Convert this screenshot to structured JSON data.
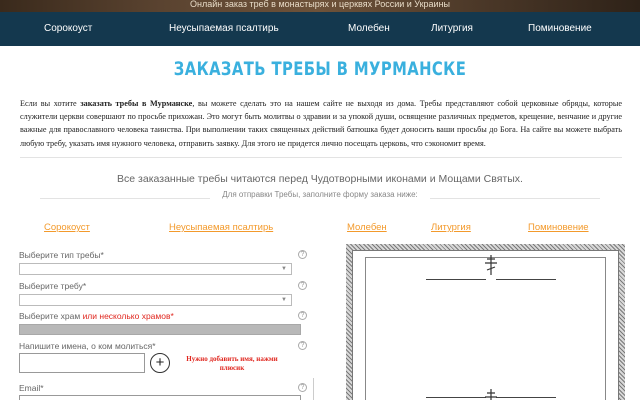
{
  "topbar": {
    "text": "Онлайн заказ треб в монастырях и церквях России и Украины"
  },
  "nav": {
    "items": [
      "Сорокоуст",
      "Неусыпаемая псалтирь",
      "Молебен",
      "Литургия",
      "Поминовение"
    ]
  },
  "title": "ЗАКАЗАТЬ ТРЕБЫ В МУРМАНСКЕ",
  "intro": {
    "lead": "Если вы хотите ",
    "bold": "заказать требы в Мурманске",
    "rest": ", вы можете сделать это на нашем сайте не выходя из дома. Требы представляют собой церковные обряды, которые служители церкви совершают по просьбе прихожан. Это могут быть молитвы о здравии и за упокой души, освящение различных предметов, крещение, венчание и другие важные для православного человека таинства. При выполнении таких священных действий батюшка будет доносить ваши просьбы до Бога. На сайте вы можете выбрать любую требу, указать имя нужного человека, отправить заявку. Для этого не придется лично посещать церковь, что сэкономит время."
  },
  "subheading": "Все заказанные требы читаются перед Чудотворными иконами и Мощами Святых.",
  "subnote": "Для отправки Требы, заполните форму заказа ниже:",
  "tabs": [
    "Сорокоуст",
    "Неусыпаемая псалтирь",
    "Молебен",
    "Литургия",
    "Поминовение"
  ],
  "form": {
    "type_label": "Выберите тип требы*",
    "treba_label": "Выберите требу*",
    "temple_label": "Выберите храм ",
    "temple_label_red": "или несколько храмов*",
    "names_label": "Напишите имена, о ком молиться*",
    "plus": "+",
    "warning": "Нужно добавить имя, нажми плюсик",
    "email_label": "Email*",
    "help": "?"
  },
  "icons": {
    "dropdown": "chevron-down-icon",
    "cross": "orthodox-cross-icon"
  }
}
